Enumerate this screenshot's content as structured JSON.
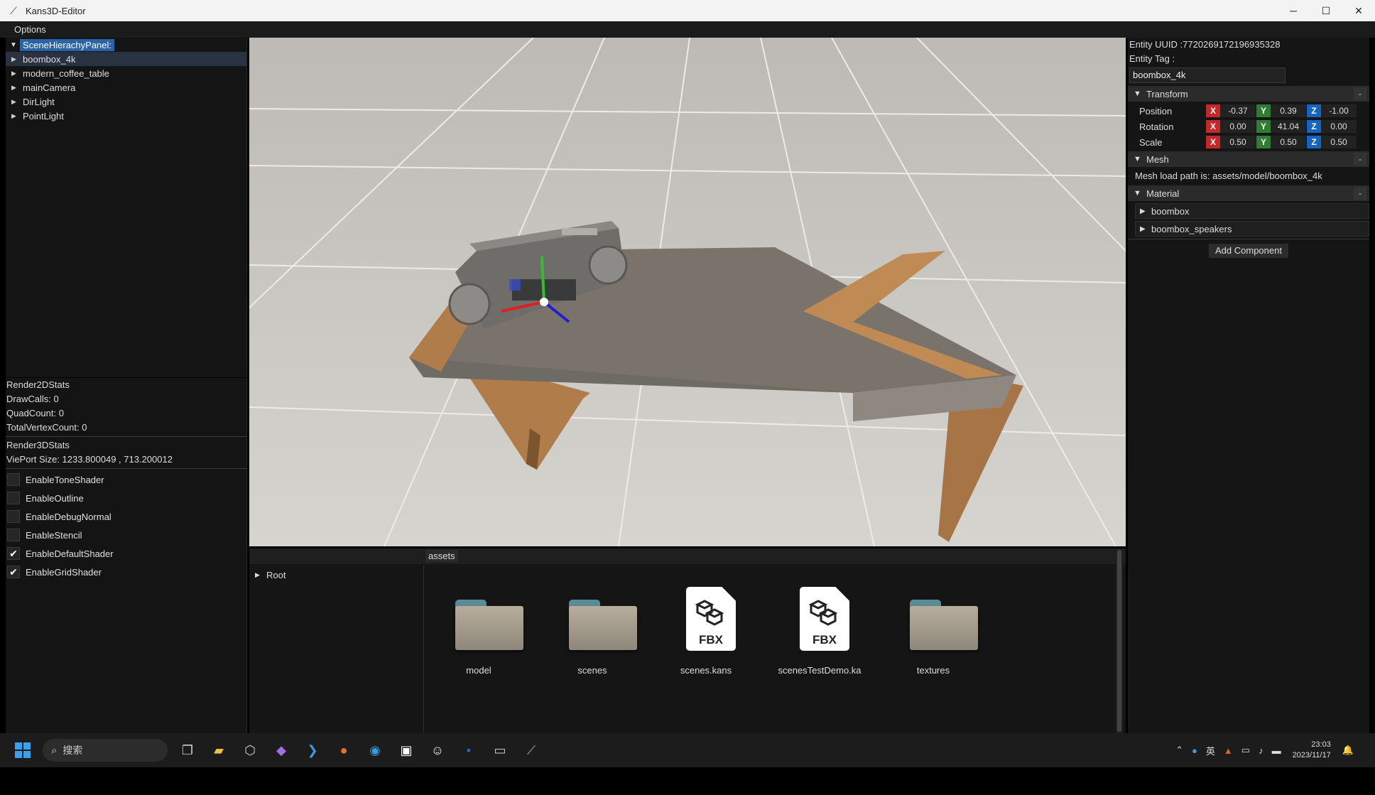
{
  "window": {
    "title": "Kans3D-Editor",
    "minimize": "─",
    "maximize": "☐",
    "close": "✕"
  },
  "menu": {
    "options": "Options"
  },
  "hierarchy": {
    "header": "SceneHierachyPanel:",
    "items": [
      {
        "label": "boombox_4k"
      },
      {
        "label": "modern_coffee_table"
      },
      {
        "label": "mainCamera"
      },
      {
        "label": "DirLight"
      },
      {
        "label": "PointLight"
      }
    ]
  },
  "stats": {
    "render2d_title": "Render2DStats",
    "draw_calls": "DrawCalls: 0",
    "quad_count": "QuadCount: 0",
    "total_vertex": "TotalVertexCount: 0",
    "render3d_title": "Render3DStats",
    "viewport_size": "ViePort Size: 1233.800049 , 713.200012"
  },
  "options": [
    {
      "label": "EnableToneShader",
      "checked": false,
      "mark": ""
    },
    {
      "label": "EnableOutline",
      "checked": false,
      "mark": ""
    },
    {
      "label": "EnableDebugNormal",
      "checked": false,
      "mark": ""
    },
    {
      "label": "EnableStencil",
      "checked": false,
      "mark": ""
    },
    {
      "label": "EnableDefaultShader",
      "checked": true,
      "mark": "✔"
    },
    {
      "label": "EnableGridShader",
      "checked": true,
      "mark": "✔"
    }
  ],
  "assets": {
    "tab": "assets",
    "root": "Root",
    "items": [
      {
        "label": "model",
        "type": "folder"
      },
      {
        "label": "scenes",
        "type": "folder"
      },
      {
        "label": "scenes.kans",
        "type": "fbx"
      },
      {
        "label": "scenesTestDemo.ka",
        "type": "fbx"
      },
      {
        "label": "textures",
        "type": "folder"
      }
    ],
    "fbx_text": "FBX"
  },
  "inspector": {
    "uuid": "Entity UUID :7720269172196935328",
    "tag_label": "Entity Tag :",
    "tag_value": "boombox_4k",
    "transform_title": "Transform",
    "collapse": "-",
    "axis_x": "X",
    "axis_y": "Y",
    "axis_z": "Z",
    "position": {
      "label": "Position",
      "x": "-0.37",
      "y": "0.39",
      "z": "-1.00"
    },
    "rotation": {
      "label": "Rotation",
      "x": "0.00",
      "y": "41.04",
      "z": "0.00"
    },
    "scale": {
      "label": "Scale",
      "x": "0.50",
      "y": "0.50",
      "z": "0.50"
    },
    "mesh_title": "Mesh",
    "mesh_path": "Mesh load path is: assets/model/boombox_4k",
    "material_title": "Material",
    "materials": [
      {
        "label": "boombox"
      },
      {
        "label": "boombox_speakers"
      }
    ],
    "add_component": "Add Component"
  },
  "taskbar": {
    "search_placeholder": "搜索",
    "tray_lang": "英",
    "time": "23:03",
    "date": "2023/11/17"
  },
  "colors": {
    "accent": "#2a63a8",
    "axis_x": "#c62828",
    "axis_y": "#2e7d32",
    "axis_z": "#1565c0"
  }
}
